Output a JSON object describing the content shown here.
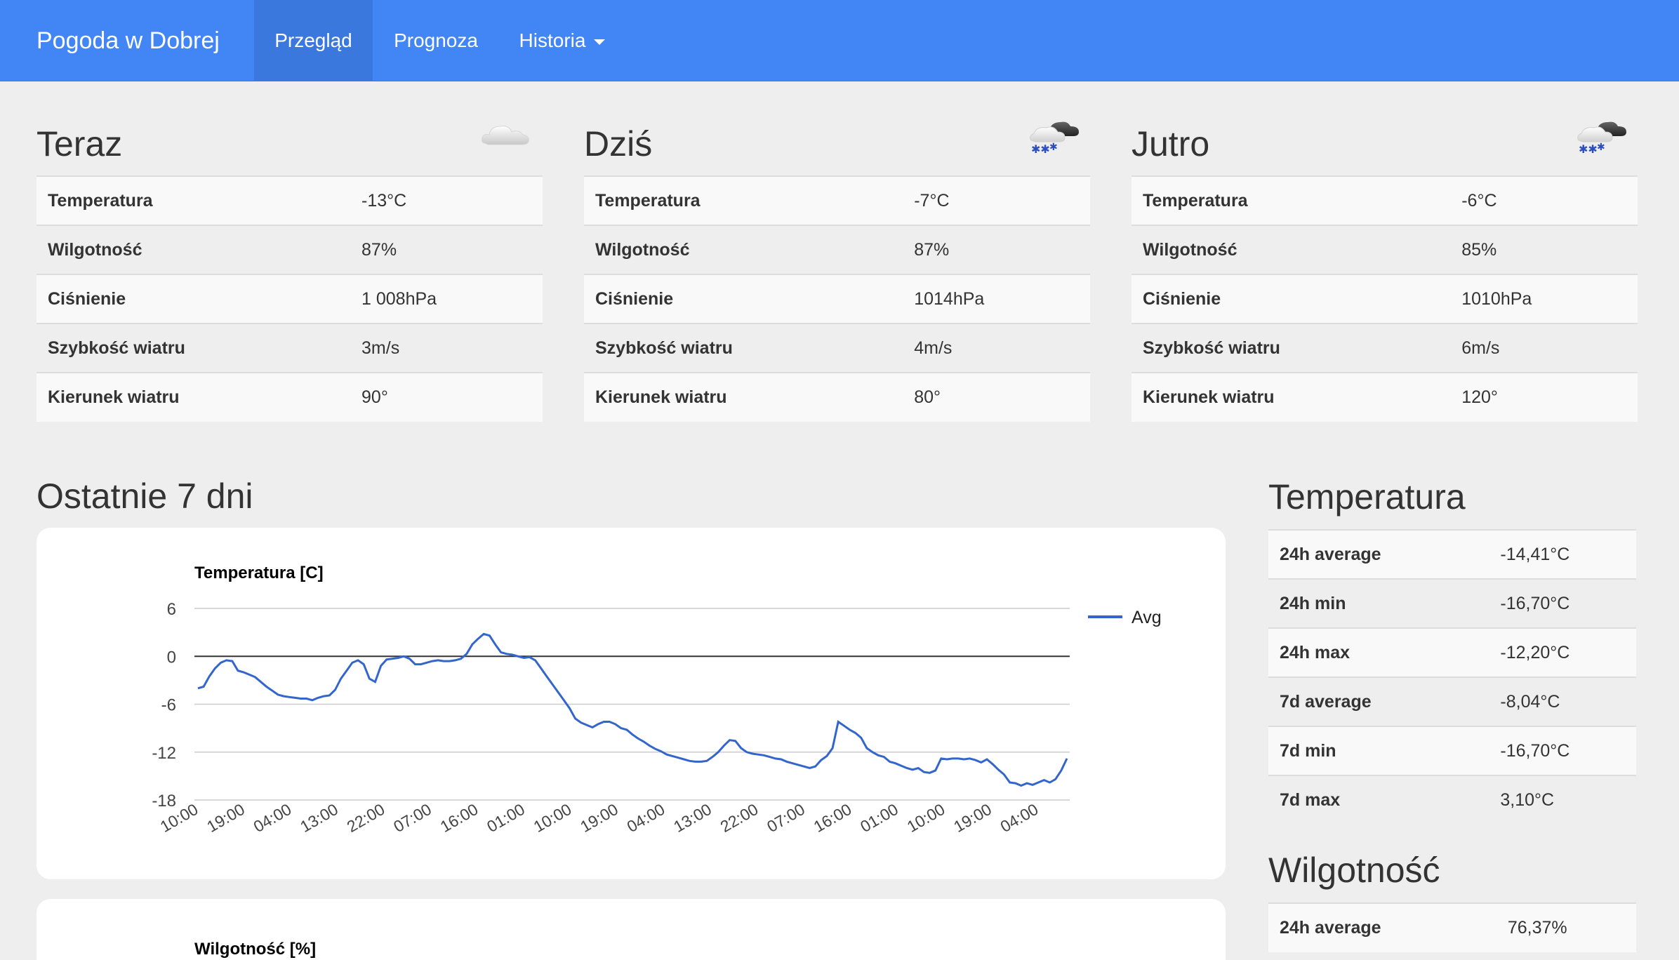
{
  "navbar": {
    "brand": "Pogoda w Dobrej",
    "items": [
      {
        "label": "Przegląd",
        "active": true
      },
      {
        "label": "Prognoza",
        "active": false
      },
      {
        "label": "Historia",
        "active": false,
        "dropdown": true
      }
    ],
    "color": "#4285f4"
  },
  "panels": [
    {
      "title": "Teraz",
      "icon": "cloud-icon",
      "rows": [
        {
          "label": "Temperatura",
          "value": "-13°C"
        },
        {
          "label": "Wilgotność",
          "value": "87%"
        },
        {
          "label": "Ciśnienie",
          "value": "1 008hPa"
        },
        {
          "label": "Szybkość wiatru",
          "value": "3m/s"
        },
        {
          "label": "Kierunek wiatru",
          "value": "90°"
        }
      ]
    },
    {
      "title": "Dziś",
      "icon": "snow-cloud-icon",
      "rows": [
        {
          "label": "Temperatura",
          "value": "-7°C"
        },
        {
          "label": "Wilgotność",
          "value": "87%"
        },
        {
          "label": "Ciśnienie",
          "value": "1014hPa"
        },
        {
          "label": "Szybkość wiatru",
          "value": "4m/s"
        },
        {
          "label": "Kierunek wiatru",
          "value": "80°"
        }
      ]
    },
    {
      "title": "Jutro",
      "icon": "snow-cloud-icon",
      "rows": [
        {
          "label": "Temperatura",
          "value": "-6°C"
        },
        {
          "label": "Wilgotność",
          "value": "85%"
        },
        {
          "label": "Ciśnienie",
          "value": "1010hPa"
        },
        {
          "label": "Szybkość wiatru",
          "value": "6m/s"
        },
        {
          "label": "Kierunek wiatru",
          "value": "120°"
        }
      ]
    }
  ],
  "last7": {
    "title": "Ostatnie 7 dni"
  },
  "chart_data": [
    {
      "type": "line",
      "title": "Temperatura [C]",
      "xlabel": "",
      "ylabel": "",
      "ylim": [
        -18,
        6
      ],
      "yticks": [
        "6",
        "0",
        "-6",
        "-12",
        "-18"
      ],
      "xticks": [
        "10:00",
        "19:00",
        "04:00",
        "13:00",
        "22:00",
        "07:00",
        "16:00",
        "01:00",
        "10:00",
        "19:00",
        "04:00",
        "13:00",
        "22:00",
        "07:00",
        "16:00",
        "01:00",
        "10:00",
        "19:00",
        "04:00"
      ],
      "grid": true,
      "legend": "right",
      "series": [
        {
          "name": "Avg",
          "color": "#3366cc",
          "values": [
            -4,
            -3.8,
            -2.5,
            -1.5,
            -0.8,
            -0.5,
            -0.6,
            -1.8,
            -2,
            -2.3,
            -2.6,
            -3.2,
            -3.8,
            -4.3,
            -4.8,
            -5,
            -5.1,
            -5.2,
            -5.3,
            -5.3,
            -5.5,
            -5.2,
            -5,
            -4.9,
            -4.2,
            -2.8,
            -1.8,
            -0.8,
            -0.5,
            -1,
            -2.8,
            -3.2,
            -1.2,
            -0.4,
            -0.3,
            -0.2,
            0,
            -0.3,
            -1,
            -1,
            -0.8,
            -0.6,
            -0.5,
            -0.6,
            -0.6,
            -0.5,
            -0.3,
            0.3,
            1.5,
            2.2,
            2.8,
            2.6,
            1.5,
            0.5,
            0.3,
            0.2,
            0,
            -0.2,
            -0.1,
            -0.5,
            -1.5,
            -2.5,
            -3.5,
            -4.5,
            -5.5,
            -6.5,
            -7.8,
            -8.3,
            -8.6,
            -8.9,
            -8.5,
            -8.2,
            -8.2,
            -8.5,
            -9,
            -9.2,
            -9.8,
            -10.3,
            -10.7,
            -11.2,
            -11.6,
            -11.9,
            -12.3,
            -12.5,
            -12.7,
            -12.9,
            -13.1,
            -13.2,
            -13.2,
            -13.1,
            -12.6,
            -12,
            -11.2,
            -10.5,
            -10.6,
            -11.5,
            -12,
            -12.2,
            -12.3,
            -12.4,
            -12.6,
            -12.8,
            -12.9,
            -13.2,
            -13.4,
            -13.6,
            -13.8,
            -14,
            -13.8,
            -13,
            -12.5,
            -11.5,
            -8.2,
            -8.7,
            -9.2,
            -9.6,
            -10.2,
            -11.5,
            -12,
            -12.4,
            -12.6,
            -13.2,
            -13.4,
            -13.7,
            -14,
            -14.2,
            -14,
            -14.5,
            -14.6,
            -14.3,
            -12.8,
            -12.9,
            -12.8,
            -12.8,
            -12.9,
            -12.8,
            -13,
            -13.3,
            -12.9,
            -13.5,
            -14.2,
            -14.8,
            -15.8,
            -15.9,
            -16.2,
            -15.9,
            -16.1,
            -15.8,
            -15.5,
            -15.8,
            -15.4,
            -14.3,
            -12.8
          ]
        }
      ]
    },
    {
      "type": "line",
      "title": "Wilgotność [%]",
      "series": []
    }
  ],
  "stats": [
    {
      "title": "Temperatura",
      "rows": [
        {
          "label": "24h average",
          "value": "-14,41°C"
        },
        {
          "label": "24h min",
          "value": "-16,70°C"
        },
        {
          "label": "24h max",
          "value": "-12,20°C"
        },
        {
          "label": "7d average",
          "value": "-8,04°C"
        },
        {
          "label": "7d min",
          "value": "-16,70°C"
        },
        {
          "label": "7d max",
          "value": "3,10°C"
        }
      ]
    },
    {
      "title": "Wilgotność",
      "rows": [
        {
          "label": "24h average",
          "value": "76,37%"
        }
      ]
    }
  ]
}
